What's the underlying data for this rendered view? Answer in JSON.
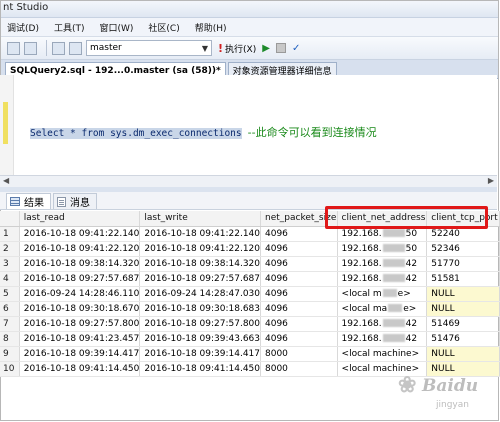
{
  "window": {
    "title_fragment": "nt Studio"
  },
  "menu": [
    "调试(D)",
    "工具(T)",
    "窗口(W)",
    "社区(C)",
    "帮助(H)"
  ],
  "toolbar": {
    "database": "master",
    "execute_label": "执行(X)"
  },
  "doc_tabs": [
    "SQLQuery2.sql - 192...0.master (sa (58))*",
    "对象资源管理器详细信息"
  ],
  "editor": {
    "code": "Select * from sys.dm_exec_connections",
    "comment": "--此命令可以看到连接情况"
  },
  "result_tabs": [
    "结果",
    "消息"
  ],
  "grid": {
    "columns": [
      "last_read",
      "last_write",
      "net_packet_size",
      "client_net_address",
      "client_tcp_port"
    ],
    "rows": [
      {
        "n": "1",
        "last_read": "2016-10-18 09:41:22.140",
        "last_write": "2016-10-18 09:41:22.140",
        "size": "4096",
        "addr_a": "192.168.",
        "addr_b": "50",
        "port": "52240"
      },
      {
        "n": "2",
        "last_read": "2016-10-18 09:41:22.120",
        "last_write": "2016-10-18 09:41:22.120",
        "size": "4096",
        "addr_a": "192.168.",
        "addr_b": "50",
        "port": "52346"
      },
      {
        "n": "3",
        "last_read": "2016-10-18 09:38:14.320",
        "last_write": "2016-10-18 09:38:14.320",
        "size": "4096",
        "addr_a": "192.168.",
        "addr_b": "42",
        "port": "51770"
      },
      {
        "n": "4",
        "last_read": "2016-10-18 09:27:57.687",
        "last_write": "2016-10-18 09:27:57.687",
        "size": "4096",
        "addr_a": "192.168.",
        "addr_b": "42",
        "port": "51581"
      },
      {
        "n": "5",
        "last_read": "2016-09-24 14:28:46.110",
        "last_write": "2016-09-24 14:28:47.030",
        "size": "4096",
        "addr_a": "<local m",
        "addr_b": "e>",
        "port": "NULL"
      },
      {
        "n": "6",
        "last_read": "2016-10-18 09:30:18.670",
        "last_write": "2016-10-18 09:30:18.683",
        "size": "4096",
        "addr_a": "<local ma",
        "addr_b": "e>",
        "port": "NULL"
      },
      {
        "n": "7",
        "last_read": "2016-10-18 09:27:57.800",
        "last_write": "2016-10-18 09:27:57.800",
        "size": "4096",
        "addr_a": "192.168.",
        "addr_b": "42",
        "port": "51469"
      },
      {
        "n": "8",
        "last_read": "2016-10-18 09:41:23.457",
        "last_write": "2016-10-18 09:39:43.663",
        "size": "4096",
        "addr_a": "192.168.",
        "addr_b": "42",
        "port": "51476"
      },
      {
        "n": "9",
        "last_read": "2016-10-18 09:39:14.417",
        "last_write": "2016-10-18 09:39:14.417",
        "size": "8000",
        "addr_a": "<local machine>",
        "addr_b": "",
        "port": "NULL"
      },
      {
        "n": "10",
        "last_read": "2016-10-18 09:41:14.450",
        "last_write": "2016-10-18 09:41:14.450",
        "size": "8000",
        "addr_a": "<local machine>",
        "addr_b": "",
        "port": "NULL"
      }
    ]
  },
  "watermark": {
    "brand": "Baidu",
    "sub": "jingyan"
  },
  "colors": {
    "highlight": "#e01818",
    "null_cell": "#fcf9d0",
    "comment": "#1a8a1a",
    "selection": "#c9d6e8"
  }
}
